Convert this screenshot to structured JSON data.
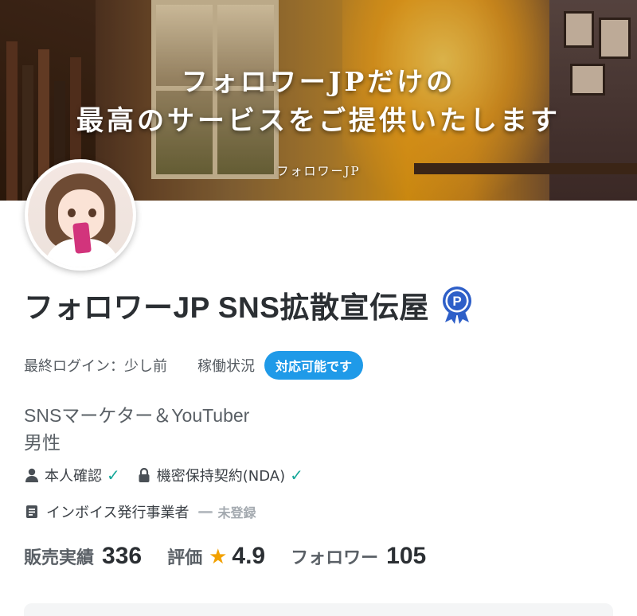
{
  "cover": {
    "title_line1": "フォロワーJPだけの",
    "title_line2": "最高のサービスをご提供いたします",
    "subtitle": "フォロワーJP"
  },
  "profile": {
    "name": "フォロワーJP SNS拡散宣伝屋",
    "badge_icon": "platinum-p-medal-icon",
    "last_login_label": "最終ログイン：",
    "last_login_value": "少し前",
    "status_label": "稼働状況",
    "status_pill": "対応可能です",
    "bio_line1": "SNSマーケター＆YouTuber",
    "bio_line2": "男性"
  },
  "verification": {
    "identity_label": "本人確認",
    "identity_icon": "person-icon",
    "nda_label": "機密保持契約(NDA)",
    "nda_icon": "lock-icon",
    "invoice_label": "インボイス発行事業者",
    "invoice_icon": "document-icon",
    "invoice_status": "未登録"
  },
  "stats": {
    "sales_label": "販売実績",
    "sales_value": "336",
    "rating_label": "評価",
    "rating_value": "4.9",
    "followers_label": "フォロワー",
    "followers_value": "105"
  },
  "colors": {
    "accent": "#1f9ae8",
    "check": "#17a89a",
    "star": "#f2a100"
  }
}
